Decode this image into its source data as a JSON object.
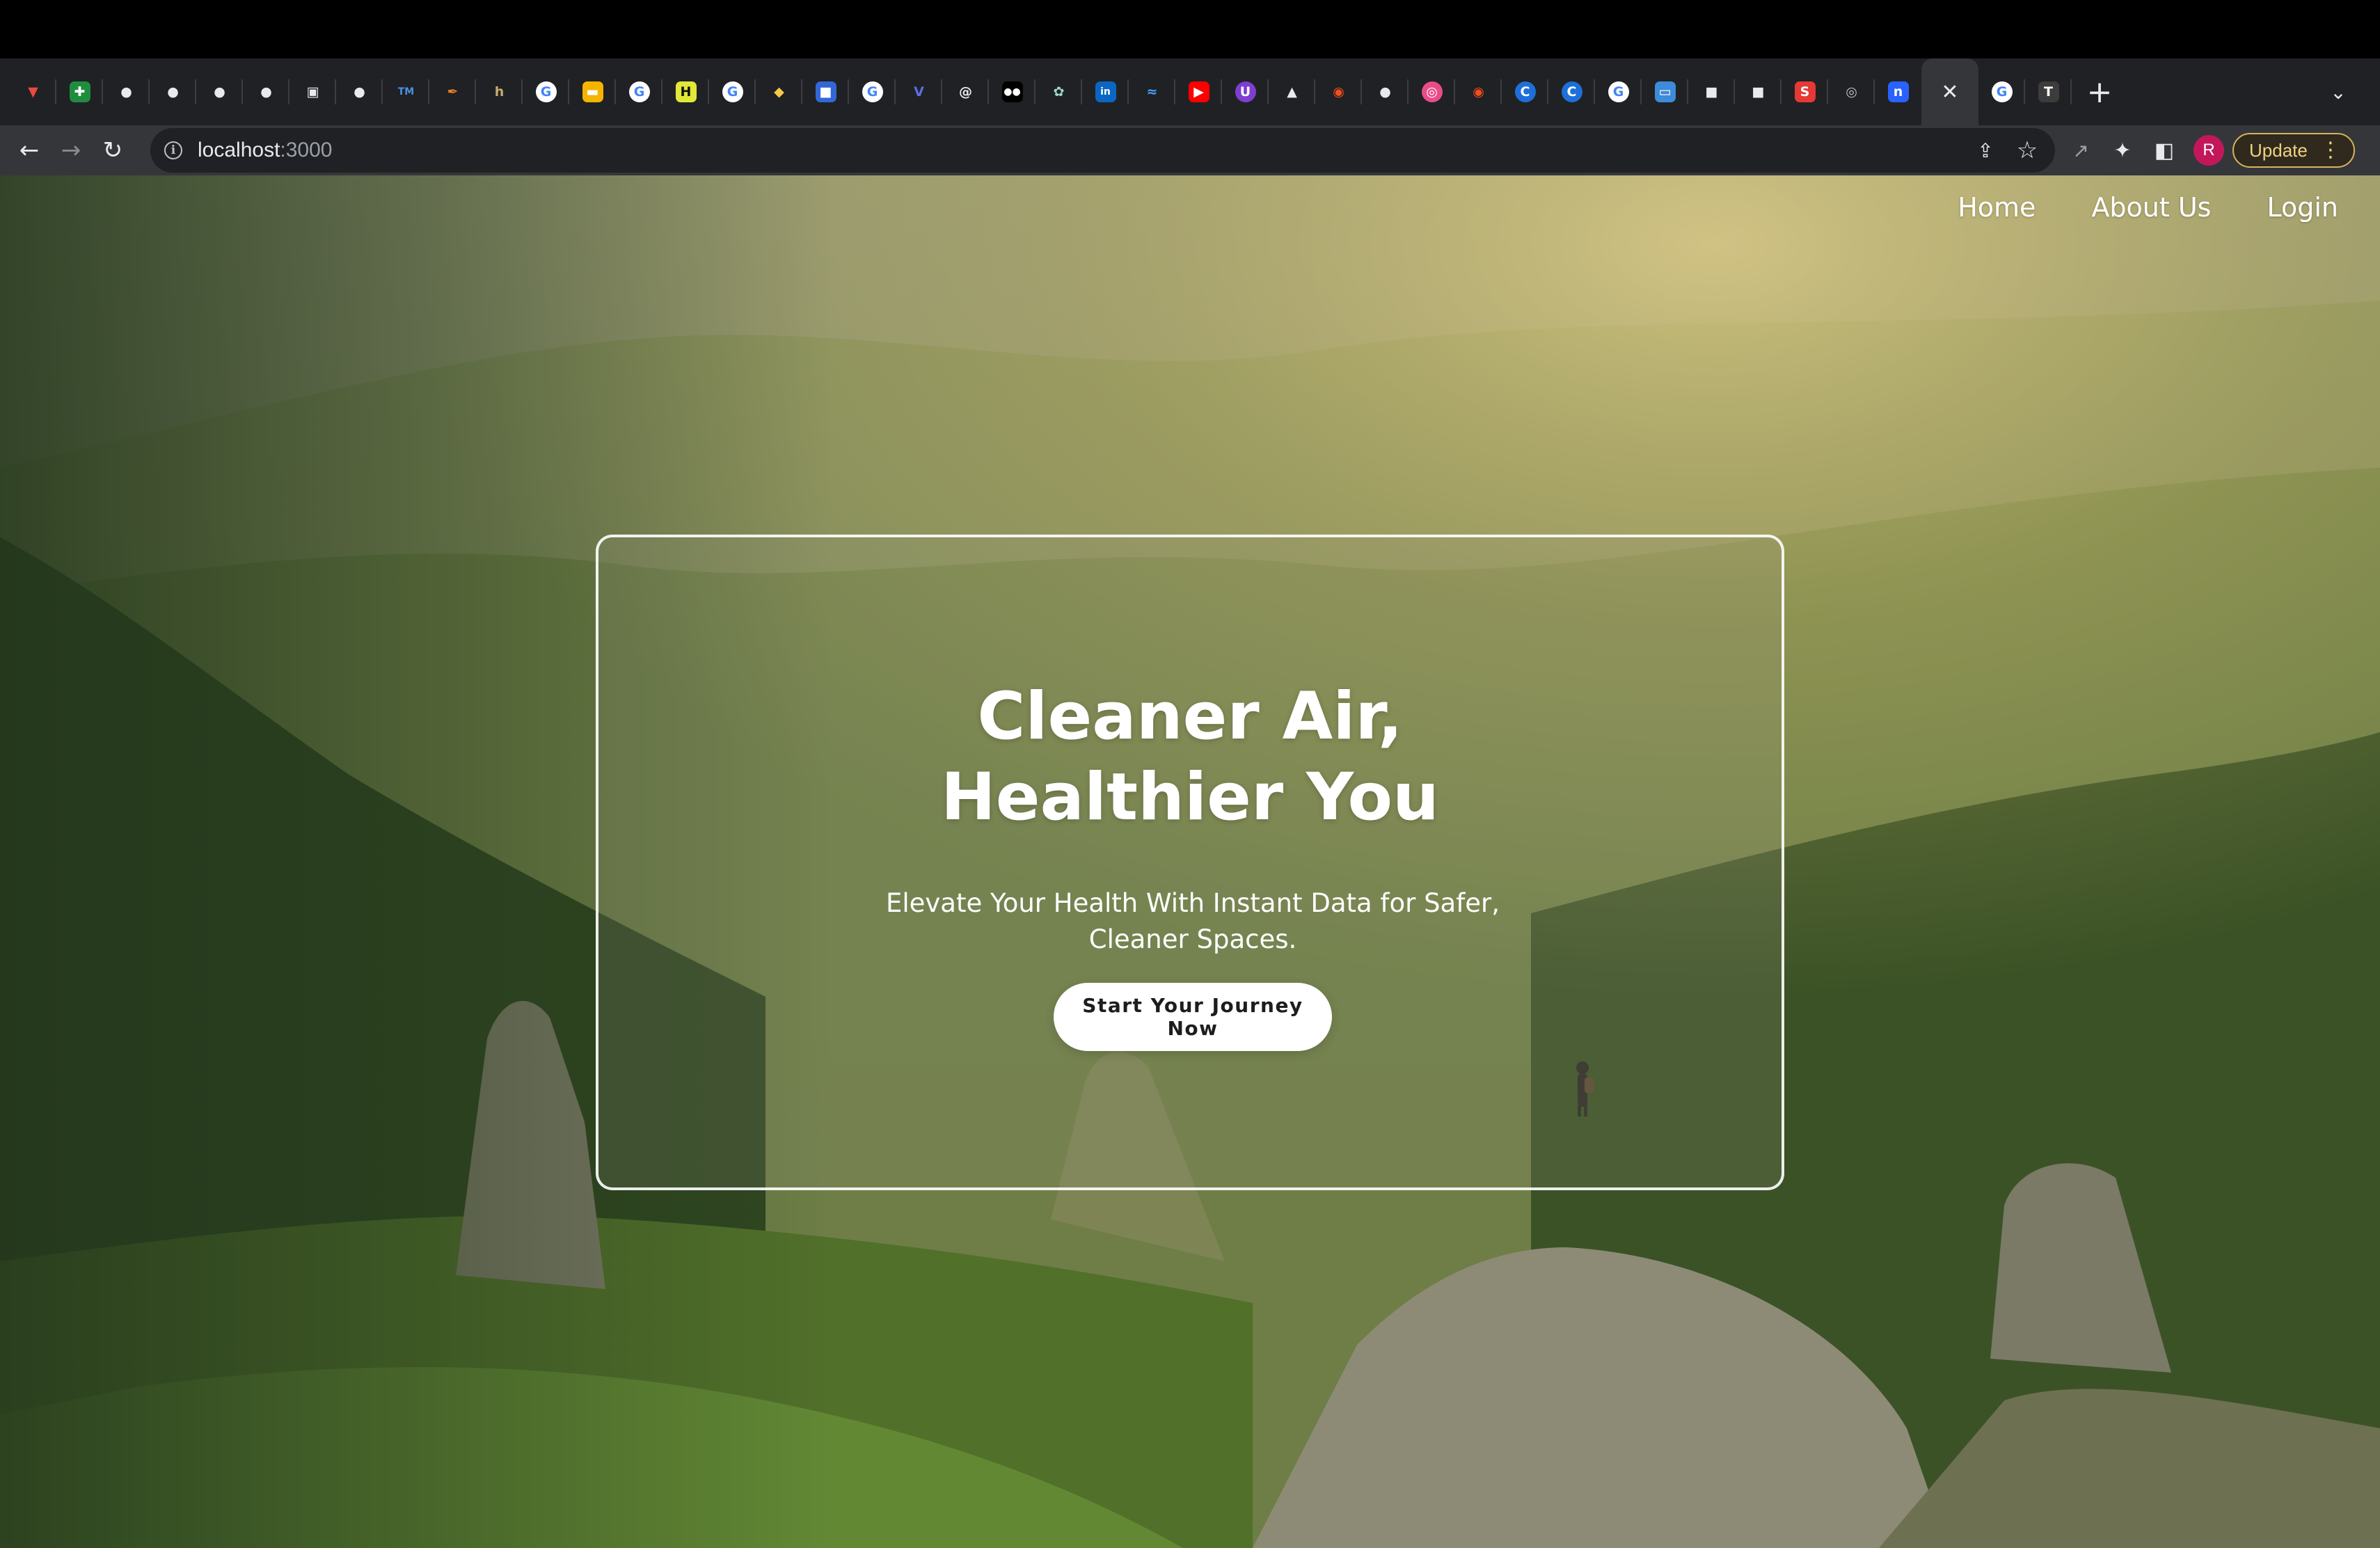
{
  "browser": {
    "tabs": [
      {
        "icon": "shield-icon",
        "glyph": "▼",
        "bg": "transparent",
        "fg": "#e74c3c"
      },
      {
        "icon": "sheets-icon",
        "glyph": "✚",
        "bg": "#1e8e3e",
        "fg": "#ffffff"
      },
      {
        "icon": "github-icon",
        "glyph": "●",
        "bg": "transparent",
        "fg": "#e8eaed"
      },
      {
        "icon": "github-icon",
        "glyph": "●",
        "bg": "transparent",
        "fg": "#e8eaed"
      },
      {
        "icon": "github-icon",
        "glyph": "●",
        "bg": "transparent",
        "fg": "#e8eaed"
      },
      {
        "icon": "github-icon",
        "glyph": "●",
        "bg": "transparent",
        "fg": "#e8eaed"
      },
      {
        "icon": "terminal-icon",
        "glyph": "▣",
        "bg": "transparent",
        "fg": "#e8eaed"
      },
      {
        "icon": "github-icon",
        "glyph": "●",
        "bg": "transparent",
        "fg": "#e8eaed"
      },
      {
        "icon": "tm-icon",
        "glyph": "TM",
        "bg": "transparent",
        "fg": "#4a90e2"
      },
      {
        "icon": "pen-icon",
        "glyph": "✒",
        "bg": "transparent",
        "fg": "#e67e22"
      },
      {
        "icon": "h-logo-icon",
        "glyph": "h",
        "bg": "transparent",
        "fg": "#c8a96e"
      },
      {
        "icon": "google-icon",
        "glyph": "G",
        "bg": "#ffffff",
        "fg": "#4285f4",
        "round": true
      },
      {
        "icon": "slides-icon",
        "glyph": "▬",
        "bg": "#f4b400",
        "fg": "#ffffff"
      },
      {
        "icon": "google-icon",
        "glyph": "G",
        "bg": "#ffffff",
        "fg": "#4285f4",
        "round": true
      },
      {
        "icon": "h-yellow-icon",
        "glyph": "H",
        "bg": "#e2e837",
        "fg": "#111111"
      },
      {
        "icon": "google-icon",
        "glyph": "G",
        "bg": "#ffffff",
        "fg": "#4285f4",
        "round": true
      },
      {
        "icon": "python-icon",
        "glyph": "◆",
        "bg": "transparent",
        "fg": "#f7c948"
      },
      {
        "icon": "square-blue-icon",
        "glyph": "■",
        "bg": "#3367d6",
        "fg": "#ffffff"
      },
      {
        "icon": "google-icon",
        "glyph": "G",
        "bg": "#ffffff",
        "fg": "#4285f4",
        "round": true
      },
      {
        "icon": "v-logo-icon",
        "glyph": "V",
        "bg": "transparent",
        "fg": "#5b6ee1"
      },
      {
        "icon": "threads-icon",
        "glyph": "@",
        "bg": "transparent",
        "fg": "#e8eaed"
      },
      {
        "icon": "medium-icon",
        "glyph": "●●",
        "bg": "#000000",
        "fg": "#ffffff"
      },
      {
        "icon": "openai-icon",
        "glyph": "✿",
        "bg": "transparent",
        "fg": "#9fd8c8"
      },
      {
        "icon": "linkedin-icon",
        "glyph": "in",
        "bg": "#0a66c2",
        "fg": "#ffffff"
      },
      {
        "icon": "stripe-icon",
        "glyph": "≈",
        "bg": "transparent",
        "fg": "#4aa3ff"
      },
      {
        "icon": "youtube-icon",
        "glyph": "▶",
        "bg": "#ff0000",
        "fg": "#ffffff"
      },
      {
        "icon": "u-logo-icon",
        "glyph": "U",
        "bg": "#7e3fd0",
        "fg": "#ffffff",
        "round": true
      },
      {
        "icon": "bell-icon",
        "glyph": "▲",
        "bg": "transparent",
        "fg": "#e8eaed"
      },
      {
        "icon": "figma-icon",
        "glyph": "◉",
        "bg": "transparent",
        "fg": "#f24e1e"
      },
      {
        "icon": "github-icon",
        "glyph": "●",
        "bg": "transparent",
        "fg": "#e8eaed"
      },
      {
        "icon": "dribbble-icon",
        "glyph": "◎",
        "bg": "#ea4c89",
        "fg": "#ffffff",
        "round": true
      },
      {
        "icon": "figma-icon",
        "glyph": "◉",
        "bg": "transparent",
        "fg": "#f24e1e"
      },
      {
        "icon": "c-logo-icon",
        "glyph": "C",
        "bg": "#1e6fd9",
        "fg": "#ffffff",
        "round": true
      },
      {
        "icon": "c-logo-icon",
        "glyph": "C",
        "bg": "#1e6fd9",
        "fg": "#ffffff",
        "round": true
      },
      {
        "icon": "google-icon",
        "glyph": "G",
        "bg": "#ffffff",
        "fg": "#4285f4",
        "round": true
      },
      {
        "icon": "image-icon",
        "glyph": "▭",
        "bg": "#3d8bd9",
        "fg": "#ffffff"
      },
      {
        "icon": "unsplash-icon",
        "glyph": "■",
        "bg": "transparent",
        "fg": "#e8eaed"
      },
      {
        "icon": "unsplash-icon",
        "glyph": "■",
        "bg": "transparent",
        "fg": "#e8eaed"
      },
      {
        "icon": "red-app-icon",
        "glyph": "S",
        "bg": "#e53935",
        "fg": "#ffffff"
      },
      {
        "icon": "globe-icon",
        "glyph": "◎",
        "bg": "transparent",
        "fg": "#bdc1c6"
      },
      {
        "icon": "n-logo-icon",
        "glyph": "n",
        "bg": "#2962ff",
        "fg": "#ffffff"
      },
      {
        "icon": "close-icon",
        "glyph": "✕",
        "active": true
      },
      {
        "icon": "google-icon",
        "glyph": "G",
        "bg": "#ffffff",
        "fg": "#4285f4",
        "round": true
      },
      {
        "icon": "t-logo-icon",
        "glyph": "T",
        "bg": "#3c3c3c",
        "fg": "#ffffff"
      }
    ],
    "new_tab_glyph": "+",
    "tab_search_glyph": "⌄",
    "nav": {
      "back": "←",
      "forward": "→",
      "reload": "↻"
    },
    "address": {
      "info_glyph": "i",
      "host": "localhost",
      "port": ":3000"
    },
    "omni_actions": {
      "share": "⇪",
      "bookmark": "☆"
    },
    "extensions": {
      "ext1": "↗",
      "puzzle": "✦",
      "sidepanel": "◧"
    },
    "profile_initial": "R",
    "update_label": "Update",
    "menu_glyph": "⋮"
  },
  "page": {
    "nav": [
      {
        "label": "Home"
      },
      {
        "label": "About Us"
      },
      {
        "label": "Login"
      }
    ],
    "hero": {
      "title_line1": "Cleaner Air,",
      "title_line2": "Healthier You",
      "subtitle": "Elevate Your Health With Instant Data for Safer, Cleaner Spaces.",
      "cta_label": "Start Your Journey Now"
    }
  }
}
